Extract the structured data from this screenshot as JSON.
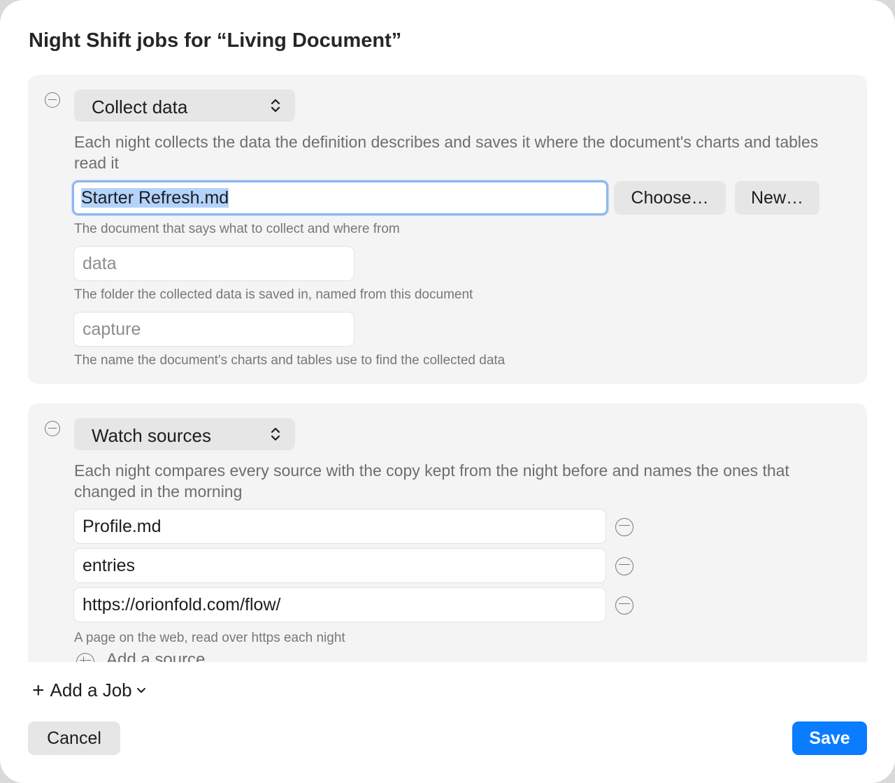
{
  "dialog": {
    "title": "Night Shift jobs for “Living Document”"
  },
  "jobs": [
    {
      "type": "Collect data",
      "description": "Each night collects the data the definition describes and saves it where the document's charts and tables read it",
      "definition_value": "Starter Refresh.md",
      "choose_label": "Choose…",
      "new_label": "New…",
      "definition_hint": "The document that says what to collect and where from",
      "folder_placeholder": "data",
      "folder_hint": "The folder the collected data is saved in, named from this document",
      "name_placeholder": "capture",
      "name_hint": "The name the document's charts and tables use to find the collected data"
    },
    {
      "type": "Watch sources",
      "description": "Each night compares every source with the copy kept from the night before and names the ones that changed in the morning",
      "sources": [
        "Profile.md",
        "entries",
        "https://orionfold.com/flow/"
      ],
      "source_hint": "A page on the web, read over https each night",
      "add_source_label": "Add a source"
    }
  ],
  "footer": {
    "add_job_label": "Add a Job",
    "cancel_label": "Cancel",
    "save_label": "Save"
  },
  "colors": {
    "accent": "#0a7cff",
    "focus_ring": "#8fb7f0",
    "selection": "#b3d3fb",
    "card_background": "#f4f4f4"
  },
  "icons": [
    "remove-job-icon",
    "popup-updown-icon",
    "remove-source-icon",
    "add-source-icon",
    "plus-icon",
    "chevron-down-icon"
  ]
}
